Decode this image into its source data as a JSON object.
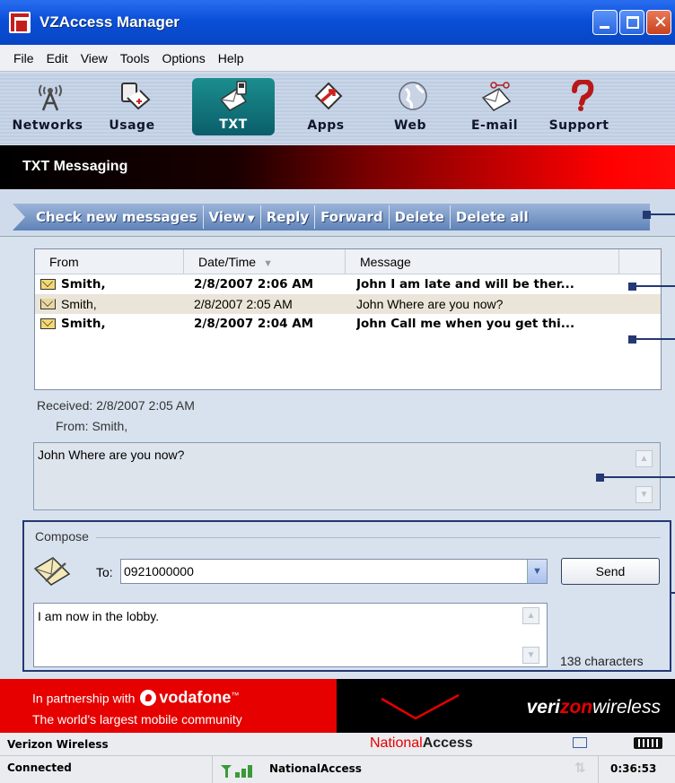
{
  "window": {
    "title": "VZAccess Manager"
  },
  "menu": [
    "File",
    "Edit",
    "View",
    "Tools",
    "Options",
    "Help"
  ],
  "toolbar": {
    "items": [
      {
        "label": "Networks",
        "icon": "antenna-icon"
      },
      {
        "label": "Usage",
        "icon": "usage-icon"
      },
      {
        "label": "TXT",
        "icon": "txt-message-icon",
        "active": true
      },
      {
        "label": "Apps",
        "icon": "apps-icon"
      },
      {
        "label": "Web",
        "icon": "globe-icon"
      },
      {
        "label": "E-mail",
        "icon": "email-icon"
      },
      {
        "label": "Support",
        "icon": "question-icon"
      }
    ]
  },
  "section": {
    "title": "TXT Messaging"
  },
  "actions": {
    "check": "Check new messages",
    "view": "View",
    "reply": "Reply",
    "forward": "Forward",
    "delete": "Delete",
    "delete_all": "Delete all"
  },
  "list": {
    "headers": {
      "from": "From",
      "date": "Date/Time",
      "message": "Message"
    },
    "rows": [
      {
        "from": "Smith,",
        "date": "2/8/2007 2:06 AM",
        "message": "John I am late and will be ther...",
        "unread": true
      },
      {
        "from": "Smith,",
        "date": "2/8/2007 2:05 AM",
        "message": "John Where are you now?",
        "unread": false
      },
      {
        "from": "Smith,",
        "date": "2/8/2007 2:04 AM",
        "message": "John Call me when you get thi...",
        "unread": true
      }
    ]
  },
  "reader": {
    "received": "Received: 2/8/2007 2:05 AM",
    "from": "From: Smith,",
    "body": "John Where are you now?"
  },
  "compose": {
    "legend": "Compose",
    "to_label": "To:",
    "to_value": "0921000000",
    "send": "Send",
    "body": "I am now in the lobby.",
    "chars": "138 characters"
  },
  "banner": {
    "partnership": "In partnership with",
    "vodafone": "vodafone",
    "tm": "™",
    "tagline": "The world's largest mobile community",
    "verizon_1": "veri",
    "verizon_z": "zon",
    "verizon_2": "wireless"
  },
  "status": {
    "carrier": "Verizon Wireless",
    "na_red": "National",
    "na_bold": "Access",
    "connected": "Connected",
    "network": "NationalAccess",
    "time": "0:36:53"
  },
  "colors": {
    "accent_red": "#e60000",
    "navy": "#243872",
    "title_blue": "#0a4fd8"
  }
}
